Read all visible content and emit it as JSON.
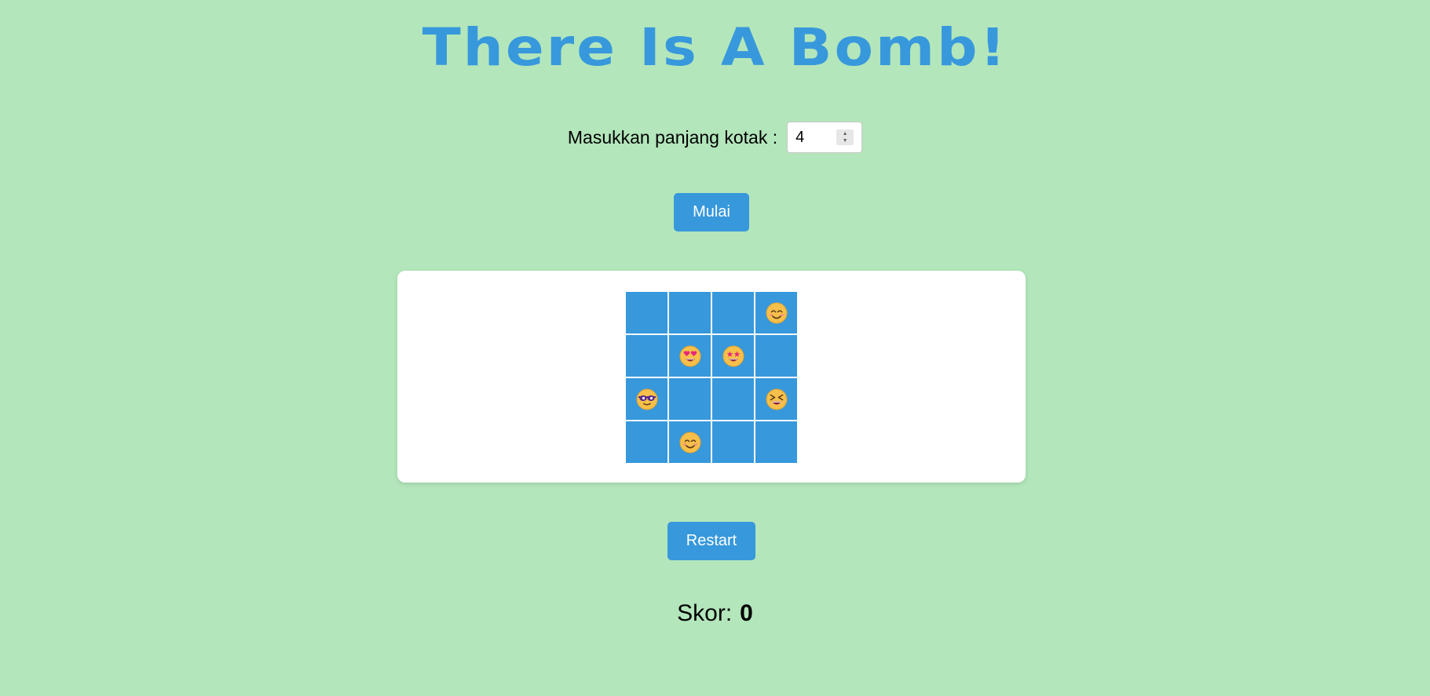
{
  "title": "There Is A Bomb!",
  "setup": {
    "label": "Masukkan panjang kotak :",
    "value": "4",
    "start_label": "Mulai"
  },
  "board": {
    "size": 4,
    "cells": [
      "",
      "",
      "",
      "smiling-face-icon",
      "",
      "heart-eyes-icon",
      "star-struck-icon",
      "",
      "cool-glasses-icon",
      "",
      "",
      "laughing-face-icon",
      "",
      "smiling-face-icon",
      "",
      ""
    ]
  },
  "restart_label": "Restart",
  "score": {
    "label": "Skor:",
    "value": "0"
  },
  "colors": {
    "background": "#b3e6bb",
    "accent": "#3798dc",
    "card": "#ffffff"
  }
}
